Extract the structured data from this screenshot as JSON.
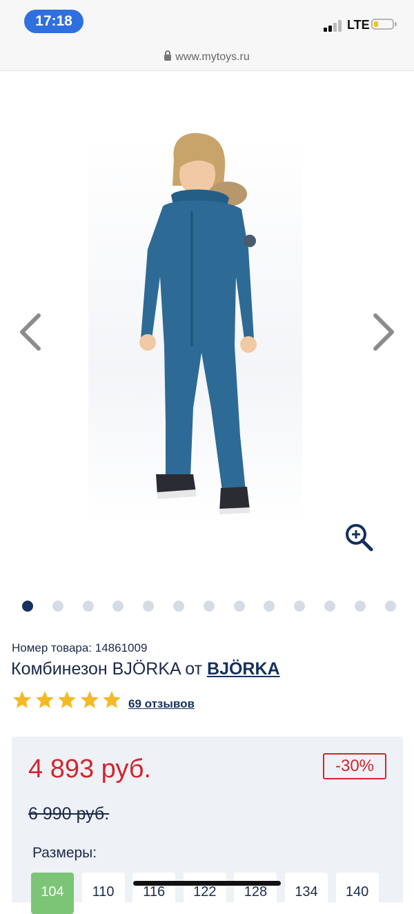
{
  "status_bar": {
    "time": "17:18",
    "network": "LTE",
    "accent_color": "#2f6fe0",
    "battery_color": "#f0c419"
  },
  "browser": {
    "url": "www.mytoys.ru"
  },
  "gallery": {
    "image_count": 13,
    "active_index": 0,
    "prev_icon": "chevron-left-icon",
    "next_icon": "chevron-right-icon",
    "zoom_icon": "zoom-in-icon"
  },
  "product": {
    "article_label": "Номер товара:",
    "article_number": "14861009",
    "name": "Комбинезон BJÖRKA",
    "from_label": "от",
    "brand": "BJÖRKA",
    "rating": 5,
    "rating_max": 5,
    "reviews_label": "69 отзывов",
    "star_color": "#f5b924"
  },
  "pricing": {
    "price": "4 893 руб.",
    "discount": "-30%",
    "old_price": "6 990 руб.",
    "price_color": "#d0262f"
  },
  "sizes": {
    "label": "Размеры:",
    "options": [
      "104",
      "110",
      "116",
      "122",
      "128",
      "134",
      "140"
    ],
    "selected": "104",
    "selected_color": "#7cc576"
  }
}
